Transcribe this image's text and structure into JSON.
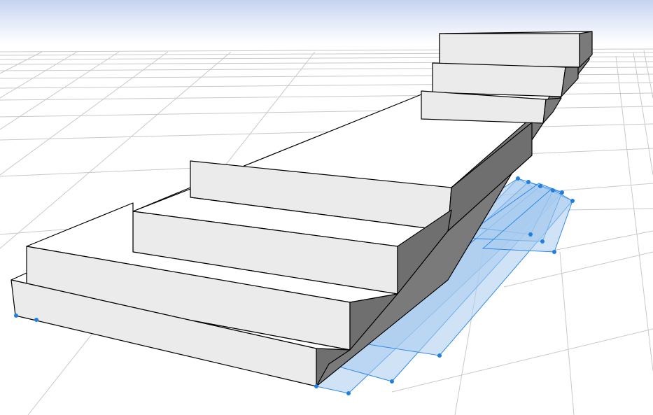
{
  "viewport": {
    "sky_top_color": "#c6d3f0",
    "sky_bottom_color": "#ffffff",
    "ground_color": "#ffffff",
    "grid_color": "#c9c9c9"
  },
  "model": {
    "object": "stair",
    "step_count": 7,
    "face_colors": {
      "top": "#ffffff",
      "front": "#ebebeb",
      "side": "#7a7a7a"
    },
    "edge_color": "#000000"
  },
  "selection": {
    "highlight_color": "#2f8be6",
    "fill_color": "#a9ccef"
  }
}
